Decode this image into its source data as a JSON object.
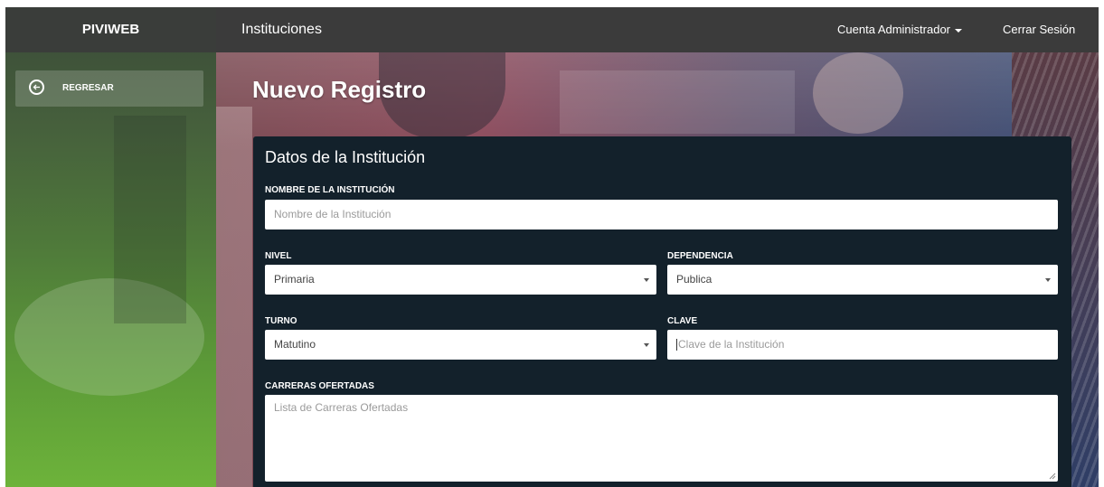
{
  "app": {
    "brand": "PIVIWEB"
  },
  "sidebar": {
    "back_label": "REGRESAR"
  },
  "header": {
    "section_title": "Instituciones",
    "account_label": "Cuenta Administrador",
    "logout_label": "Cerrar Sesión"
  },
  "page": {
    "title": "Nuevo Registro"
  },
  "form": {
    "title": "Datos de la Institución",
    "name_label": "NOMBRE DE LA INSTITUCIÓN",
    "name_placeholder": "Nombre de la Institución",
    "level_label": "NIVEL",
    "level_value": "Primaria",
    "dependency_label": "DEPENDENCIA",
    "dependency_value": "Publica",
    "shift_label": "TURNO",
    "shift_value": "Matutino",
    "key_label": "CLAVE",
    "key_placeholder": "Clave de la Institución",
    "careers_label": "CARRERAS OFERTADAS",
    "careers_placeholder": "Lista de Carreras Ofertadas"
  },
  "icons": {
    "back": "circle-arrow-left-icon",
    "account_caret": "caret-down-icon",
    "select_arrow": "triangle-down-icon"
  },
  "colors": {
    "topbar": "#3b3b3b",
    "panel": "#13212b",
    "sidebar_top": "#3a4a38",
    "sidebar_bottom": "#6db33a"
  }
}
